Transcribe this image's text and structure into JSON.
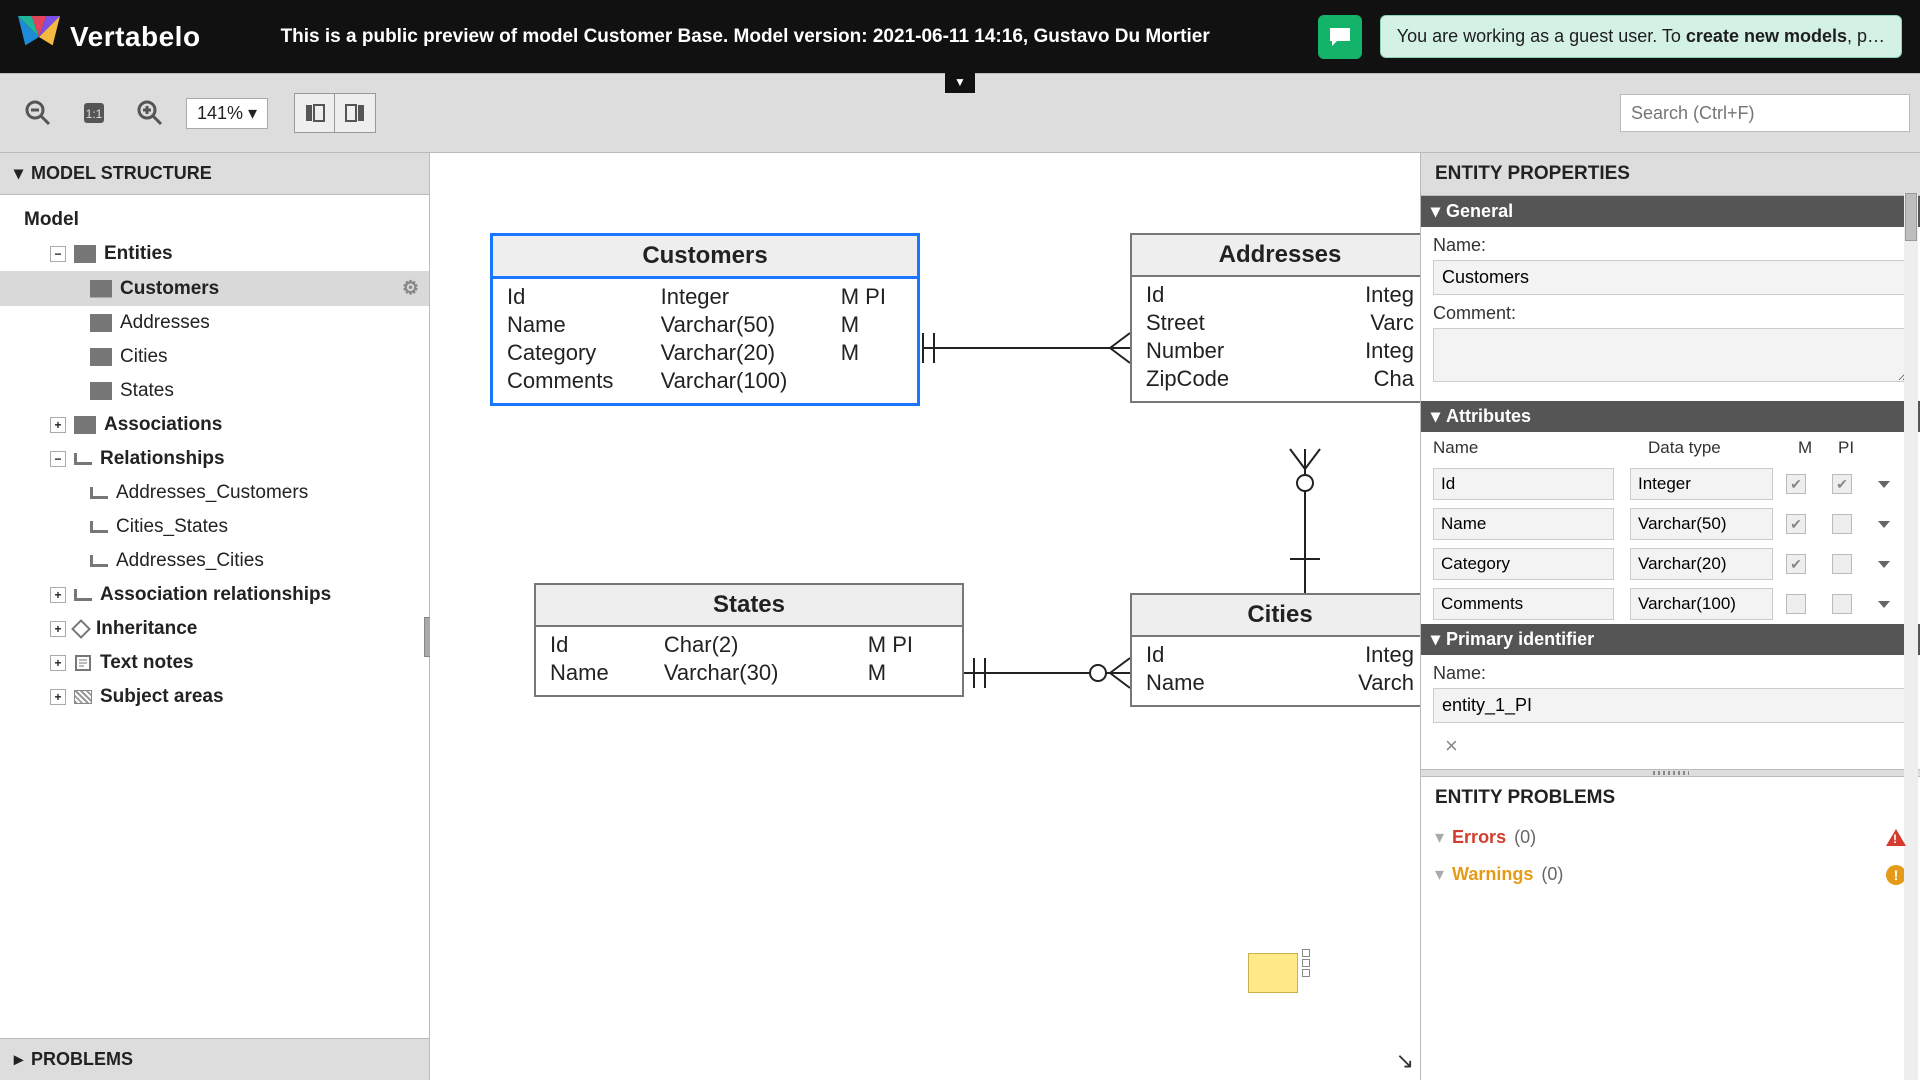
{
  "header": {
    "brand": "Vertabelo",
    "preview_text": "This is a public preview of model Customer Base. Model version: 2021-06-11 14:16, Gustavo Du Mortier",
    "guest_banner_prefix": "You are working as a guest user. To ",
    "guest_banner_bold": "create new models",
    "guest_banner_suffix": ", p…"
  },
  "toolbar": {
    "zoom": "141% ▾",
    "search_placeholder": "Search (Ctrl+F)"
  },
  "left_panel": {
    "title": "MODEL STRUCTURE",
    "root": "Model",
    "entities_label": "Entities",
    "entities": [
      "Customers",
      "Addresses",
      "Cities",
      "States"
    ],
    "associations_label": "Associations",
    "relationships_label": "Relationships",
    "relationships": [
      "Addresses_Customers",
      "Cities_States",
      "Addresses_Cities"
    ],
    "assoc_rel_label": "Association relationships",
    "inheritance_label": "Inheritance",
    "text_notes_label": "Text notes",
    "subject_areas_label": "Subject areas",
    "problems_label": "PROBLEMS"
  },
  "canvas": {
    "customers": {
      "title": "Customers",
      "rows": [
        {
          "n": "Id",
          "t": "Integer",
          "f": "M PI"
        },
        {
          "n": "Name",
          "t": "Varchar(50)",
          "f": "M"
        },
        {
          "n": "Category",
          "t": "Varchar(20)",
          "f": "M"
        },
        {
          "n": "Comments",
          "t": "Varchar(100)",
          "f": ""
        }
      ]
    },
    "addresses": {
      "title": "Addresses",
      "rows": [
        {
          "n": "Id",
          "t": "Integ"
        },
        {
          "n": "Street",
          "t": "Varc"
        },
        {
          "n": "Number",
          "t": "Integ"
        },
        {
          "n": "ZipCode",
          "t": "Cha"
        }
      ]
    },
    "states": {
      "title": "States",
      "rows": [
        {
          "n": "Id",
          "t": "Char(2)",
          "f": "M PI"
        },
        {
          "n": "Name",
          "t": "Varchar(30)",
          "f": "M"
        }
      ]
    },
    "cities": {
      "title": "Cities",
      "rows": [
        {
          "n": "Id",
          "t": "Integ"
        },
        {
          "n": "Name",
          "t": "Varch"
        }
      ]
    }
  },
  "right_panel": {
    "title": "ENTITY PROPERTIES",
    "general_label": "General",
    "name_label": "Name:",
    "name_value": "Customers",
    "comment_label": "Comment:",
    "attributes_label": "Attributes",
    "attr_head": {
      "c1": "Name",
      "c2": "Data type",
      "c3": "M",
      "c4": "PI"
    },
    "attributes": [
      {
        "name": "Id",
        "type": "Integer",
        "m": true,
        "pi": true
      },
      {
        "name": "Name",
        "type": "Varchar(50)",
        "m": true,
        "pi": false
      },
      {
        "name": "Category",
        "type": "Varchar(20)",
        "m": true,
        "pi": false
      },
      {
        "name": "Comments",
        "type": "Varchar(100)",
        "m": false,
        "pi": false
      }
    ],
    "pi_label": "Primary identifier",
    "pi_name_label": "Name:",
    "pi_value": "entity_1_PI",
    "problems_title": "ENTITY PROBLEMS",
    "errors_label": "Errors",
    "errors_count": "(0)",
    "warnings_label": "Warnings",
    "warnings_count": "(0)"
  }
}
